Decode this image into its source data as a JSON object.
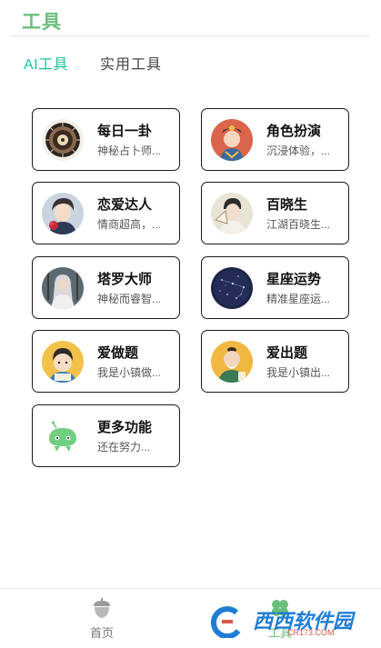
{
  "header": {
    "title": "工具"
  },
  "tabs": [
    {
      "label": "AI工具",
      "active": true
    },
    {
      "label": "实用工具",
      "active": false
    }
  ],
  "tools": [
    {
      "title": "每日一卦",
      "desc": "神秘占卜师...",
      "icon": "bagua-compass-avatar"
    },
    {
      "title": "角色扮演",
      "desc": "沉浸体验，...",
      "icon": "opera-character-avatar"
    },
    {
      "title": "恋爱达人",
      "desc": "情商超高，...",
      "icon": "romantic-man-avatar"
    },
    {
      "title": "百晓生",
      "desc": "江湖百晓生...",
      "icon": "scholar-fan-avatar"
    },
    {
      "title": "塔罗大师",
      "desc": "神秘而睿智...",
      "icon": "tarot-master-avatar"
    },
    {
      "title": "星座运势",
      "desc": "精准星座运...",
      "icon": "starry-sky-avatar"
    },
    {
      "title": "爱做题",
      "desc": "我是小镇做...",
      "icon": "student-boy-avatar"
    },
    {
      "title": "爱出题",
      "desc": "我是小镇出...",
      "icon": "teacher-old-man-avatar"
    },
    {
      "title": "更多功能",
      "desc": "还在努力...",
      "icon": "robot-avatar"
    }
  ],
  "bottom_nav": [
    {
      "label": "首页",
      "icon": "acorn-icon",
      "active": false
    },
    {
      "label": "工具",
      "icon": "clover-icon",
      "active": true
    }
  ],
  "watermark": {
    "text": "西西软件园",
    "sub": "CR173.COM"
  },
  "colors": {
    "accent": "#1ec0a3",
    "brand_green": "#6bbf7c"
  }
}
